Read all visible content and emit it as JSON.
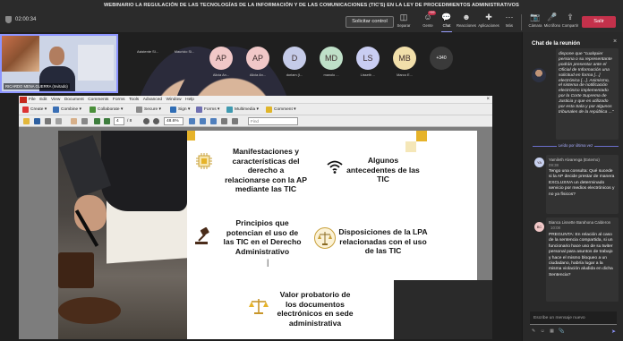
{
  "meeting": {
    "title": "WEBINARIO LA REGULACIÓN DE LAS TECNOLOGÍAS DE LA INFORMACIÓN Y DE LAS COMUNICACIONES (TIC'S) EN LA LEY DE PROCEDIMIENTOS ADMINISTRATIVOS",
    "timer": "02:00:34",
    "stop_button": "Solicitar control",
    "leave_button": "Salir"
  },
  "toolbar": [
    {
      "id": "separar",
      "icon": "◫",
      "label": "Separar"
    },
    {
      "id": "gente",
      "icon": "☺",
      "label": "Gente",
      "badge": "+99"
    },
    {
      "id": "chat",
      "icon": "💬",
      "label": "Chat"
    },
    {
      "id": "reacciones",
      "icon": "☻",
      "label": "Reacciones"
    },
    {
      "id": "aplicaciones",
      "icon": "✚",
      "label": "Aplicaciones"
    },
    {
      "id": "mas",
      "icon": "···",
      "label": "Más"
    },
    {
      "id": "camara",
      "icon": "📷",
      "label": "Cámara"
    },
    {
      "id": "microfono",
      "icon": "🎤",
      "label": "Micrófono"
    },
    {
      "id": "compartir",
      "icon": "⇪",
      "label": "Compartir"
    }
  ],
  "participants": [
    {
      "name": "Asistente SI...",
      "initials": "",
      "color": "#cfcfcf",
      "photo": true
    },
    {
      "name": "Mauricio Si...",
      "initials": "",
      "color": "#cfcfcf",
      "photo": true
    },
    {
      "name": "Alicia An...",
      "initials": "AP",
      "color": "#f1c8c8"
    },
    {
      "name": "Alicia An...",
      "initials": "AP",
      "color": "#f1c8c8"
    },
    {
      "name": "doriam (I...",
      "initials": "D",
      "color": "#c5cbe8"
    },
    {
      "name": "manolo ...",
      "initials": "MD",
      "color": "#bfe0c8"
    },
    {
      "name": "Lisseth ...",
      "initials": "LS",
      "color": "#c9cdf2"
    },
    {
      "name": "Marco E...",
      "initials": "MB",
      "color": "#f1dfaa"
    }
  ],
  "more_participants": "+340",
  "self_video": {
    "label": "RICARDO MENA GUERRA (Invitado)"
  },
  "pdf_viewer": {
    "menu": [
      "File",
      "Edit",
      "View",
      "Document",
      "Comments",
      "Forms",
      "Tools",
      "Advanced",
      "Window",
      "Help"
    ],
    "row1": [
      "Create ▾",
      "Combine ▾",
      "Collaborate ▾",
      "Secure ▾",
      "Sign ▾",
      "Forms ▾",
      "Multimedia ▾",
      "Comment ▾"
    ],
    "page_current": "4",
    "page_total": "/ 8",
    "zoom": "48.6%",
    "find_placeholder": "Find"
  },
  "slide": {
    "items": [
      "Manifestaciones y características del derecho a relacionarse con la AP mediante las TIC",
      "Algunos antecedentes de las TIC",
      "Principios que potencian el uso de las TIC en el Derecho Administrativo",
      "Disposiciones de la LPA relacionadas con el uso de las TIC",
      "Valor probatorio de los documentos electrónicos en sede administrativa"
    ]
  },
  "chat": {
    "title": "Chat de la reunión",
    "prev_message": "dispone que \"cualquier persona o su representante podrán presentar ante el Oficial de Información una solicitud en forma [...] electrónica [...]. Asimismo, el sistema de notificación electrónico implementado por la Corte Suprema de Justicia y que es utilizado por esta Sala y por algunos tribunales de la república ...\"",
    "read_marker": "Leído por última vez",
    "messages": [
      {
        "initials": "YA",
        "avatar_color": "#c7d0ee",
        "author": "Yamileth Alvarenga (Externo)",
        "time": "09:38",
        "text": "Tengo una consulta: Qué sucede si la AP decide prestar de manera EXCLUSIVA un determinado servicio por medios electrónicos y no ya físicos?"
      },
      {
        "initials": "BC",
        "avatar_color": "#f1c8c8",
        "author": "Bianca Lissette Barahona Calderon",
        "time": "10:08",
        "text": "PREGUNTA: En relación al caso de la sentencia compartida, si un funcionario hace uso de su twiter personal para asuntos de trabajo y hace el mismo bloqueo a un ciudadano, habría lugar a la misma violación aludida en dicha Sentencia?"
      }
    ],
    "input_placeholder": "Escribe un mensaje nuevo"
  },
  "colors": {
    "accent": "#8d95ff",
    "leave": "#c4314b",
    "slide_gold": "#e6b32a"
  }
}
